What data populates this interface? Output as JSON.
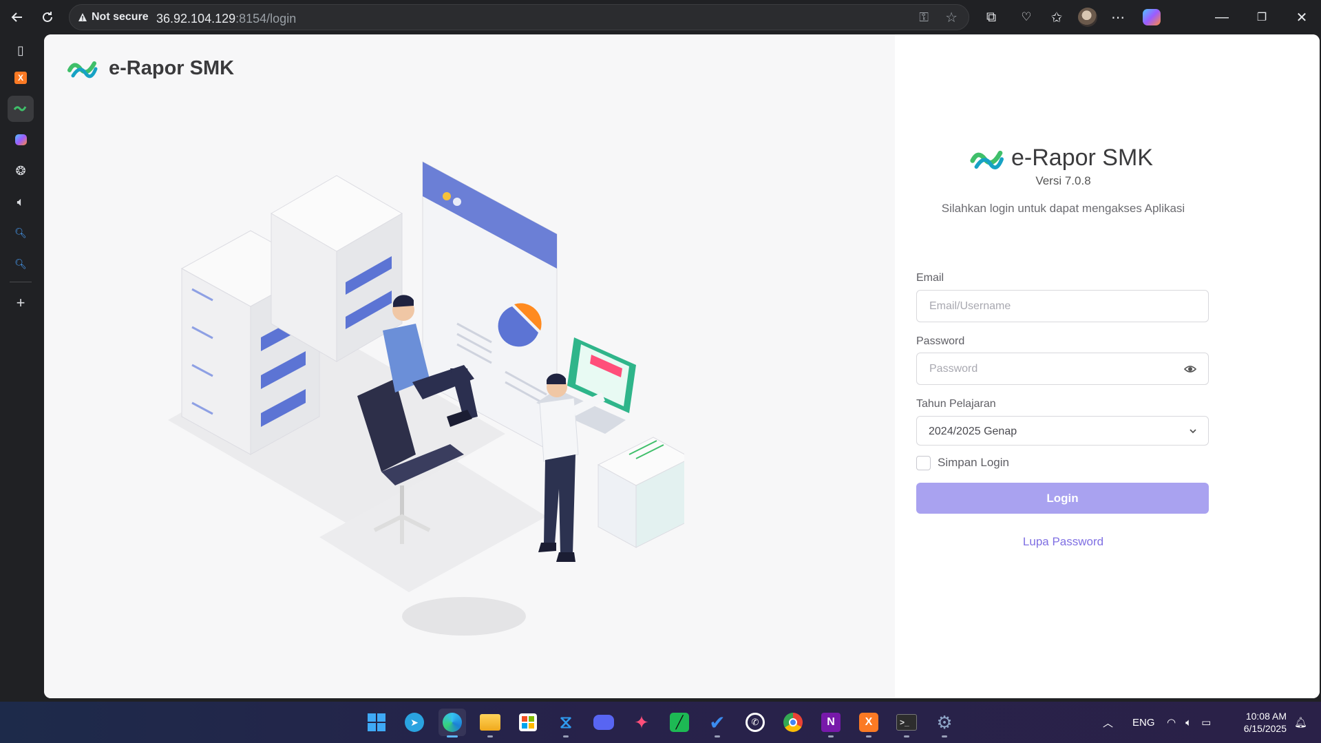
{
  "browser": {
    "security_label": "Not secure",
    "url_host": "36.92.104.129",
    "url_rest": ":8154/login"
  },
  "page": {
    "brand_name": "e-Rapor SMK",
    "version": "Versi 7.0.8",
    "subtitle": "Silahkan login untuk dapat mengakses Aplikasi"
  },
  "form": {
    "email_label": "Email",
    "email_placeholder": "Email/Username",
    "email_value": "",
    "password_label": "Password",
    "password_placeholder": "Password",
    "year_label": "Tahun Pelajaran",
    "year_value": "2024/2025 Genap",
    "remember_label": "Simpan Login",
    "remember_checked": false,
    "login_label": "Login",
    "forgot_label": "Lupa Password"
  },
  "colors": {
    "accent": "#a9a2f0",
    "link": "#7f6fe3",
    "logo_green": "#3fbf6a",
    "logo_teal": "#17a2c4"
  },
  "taskbar": {
    "language": "ENG",
    "time": "10:08 AM",
    "date": "6/15/2025",
    "apps": [
      "windows-start",
      "telegram",
      "edge",
      "file-explorer",
      "microsoft-store",
      "vscode",
      "discord",
      "app-colorful",
      "app-green",
      "todo",
      "whatsapp",
      "chrome",
      "onenote",
      "xampp",
      "terminal",
      "settings"
    ]
  }
}
